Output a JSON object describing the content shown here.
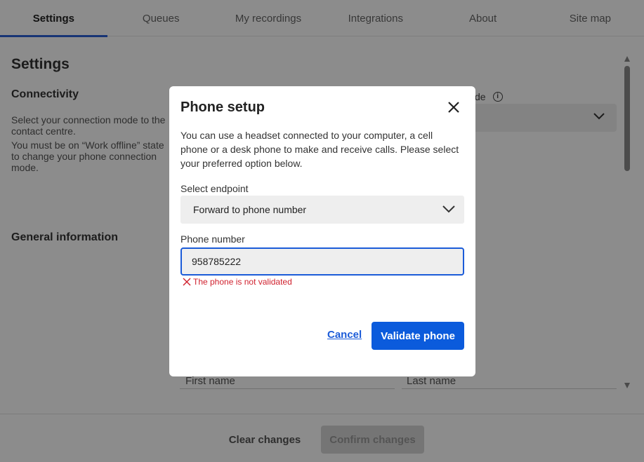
{
  "tabs": [
    {
      "label": "Settings",
      "active": true
    },
    {
      "label": "Queues"
    },
    {
      "label": "My recordings"
    },
    {
      "label": "Integrations"
    },
    {
      "label": "About"
    },
    {
      "label": "Site map"
    }
  ],
  "page": {
    "title": "Settings",
    "connectivity": {
      "title": "Connectivity",
      "desc1": "Select your connection mode to the contact centre.",
      "desc2": "You must be on “Work offline” state to change your phone connection mode.",
      "mode_label_fragment": "de",
      "info_icon": "info-icon"
    },
    "general_info": {
      "title": "General information",
      "first_name_label": "First name",
      "last_name_label": "Last name"
    },
    "footer": {
      "clear_label": "Clear changes",
      "confirm_label": "Confirm changes"
    }
  },
  "modal": {
    "title": "Phone setup",
    "close_icon": "close-icon",
    "description": "You can use a headset connected to your computer, a cell phone or a desk phone to make and receive calls. Please select your preferred option below.",
    "endpoint_label": "Select endpoint",
    "endpoint_value": "Forward to phone number",
    "phone_label": "Phone number",
    "phone_value": "958785222",
    "error_text": "The phone is not validated",
    "cancel_label": "Cancel",
    "validate_label": "Validate phone"
  },
  "colors": {
    "accent": "#0b5bdc",
    "error": "#d0212e",
    "tab_underline": "#2a5fd6"
  }
}
